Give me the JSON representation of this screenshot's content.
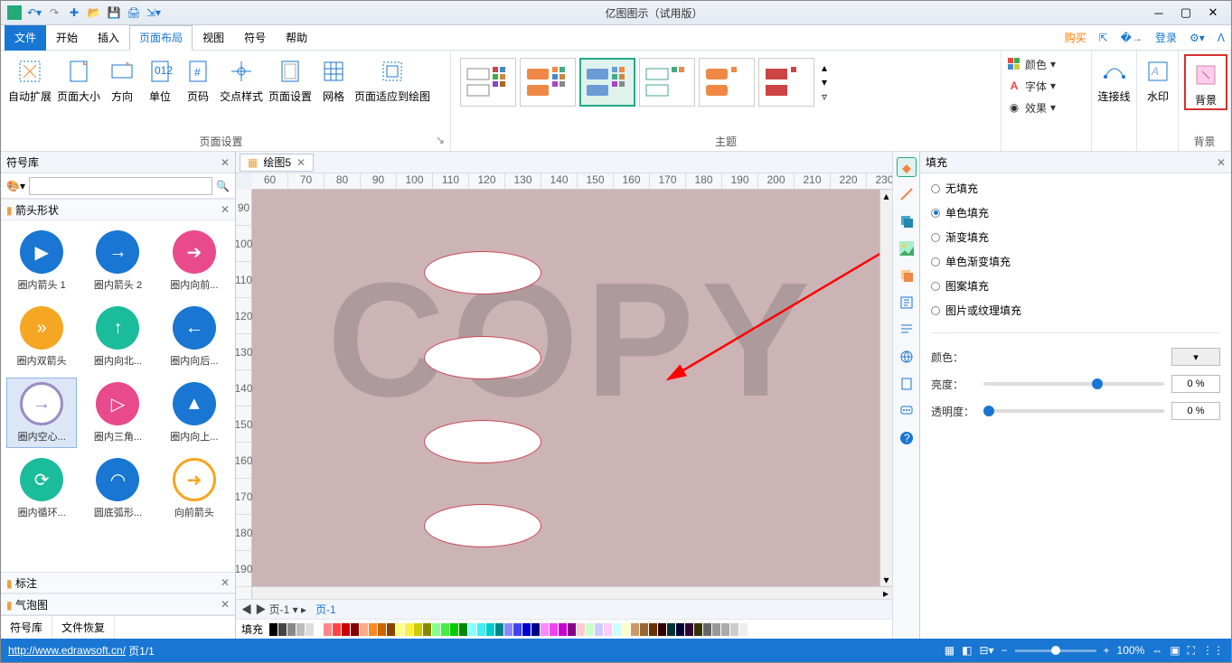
{
  "title": "亿图图示（试用版）",
  "menu": {
    "file": "文件",
    "home": "开始",
    "insert": "插入",
    "layout": "页面布局",
    "view": "视图",
    "symbol": "符号",
    "help": "帮助"
  },
  "topright": {
    "buy": "购买",
    "login": "登录"
  },
  "ribbon": {
    "pagesetup": {
      "label": "页面设置",
      "auto": "自动扩展",
      "size": "页面大小",
      "dir": "方向",
      "unit": "单位",
      "pgno": "页码",
      "cross": "交点样式",
      "pgset": "页面设置",
      "grid": "网格",
      "fit": "页面适应到绘图"
    },
    "theme": {
      "label": "主题"
    },
    "side": {
      "color": "颜色",
      "font": "字体",
      "effect": "效果",
      "connector": "连接线",
      "watermark": "水印",
      "background": "背景",
      "bglabel": "背景"
    }
  },
  "left": {
    "title": "符号库",
    "section": "箭头形状",
    "annot": "标注",
    "bubble": "气泡图",
    "tab1": "符号库",
    "tab2": "文件恢复",
    "shapes": [
      "圈内箭头 1",
      "圈内箭头 2",
      "圈内向前...",
      "圈内双箭头",
      "圈内向北...",
      "圈内向后...",
      "圈内空心...",
      "圈内三角...",
      "圈内向上...",
      "圈内循环...",
      "圆底弧形...",
      "向前箭头"
    ]
  },
  "doc": {
    "tab": "绘图5",
    "page": "页-1",
    "page2": "页-1",
    "fill": "填充",
    "ruler_h": [
      60,
      70,
      80,
      90,
      100,
      110,
      120,
      130,
      140,
      150,
      160,
      170,
      180,
      190,
      200,
      210,
      220,
      230
    ],
    "ruler_v": [
      90,
      100,
      110,
      120,
      130,
      140,
      150,
      160,
      170,
      180,
      190
    ],
    "watermark": "COPY"
  },
  "right": {
    "title": "填充",
    "opts": [
      "无填充",
      "单色填充",
      "渐变填充",
      "单色渐变填充",
      "图案填充",
      "图片或纹理填充"
    ],
    "selected": 1,
    "color": "颜色：",
    "bright": "亮度：",
    "trans": "透明度：",
    "brightval": "0 %",
    "transval": "0 %"
  },
  "status": {
    "url": "http://www.edrawsoft.cn/",
    "page": "页1/1",
    "zoom": "100%"
  },
  "colorbar": [
    "#000",
    "#444",
    "#888",
    "#bbb",
    "#ddd",
    "#fff",
    "#f88",
    "#f44",
    "#c00",
    "#800",
    "#fa8",
    "#f82",
    "#c60",
    "#840",
    "#ff8",
    "#fe4",
    "#cc0",
    "#880",
    "#8f8",
    "#4e4",
    "#0c0",
    "#080",
    "#8ff",
    "#4ee",
    "#0cc",
    "#088",
    "#88f",
    "#44e",
    "#00c",
    "#008",
    "#f8f",
    "#e4e",
    "#c0c",
    "#808",
    "#fcc",
    "#cfc",
    "#ccf",
    "#fcf",
    "#cff",
    "#ffc",
    "#c96",
    "#963",
    "#630",
    "#300",
    "#033",
    "#003",
    "#303",
    "#330",
    "#666",
    "#999",
    "#aaa",
    "#ccc",
    "#eee"
  ]
}
